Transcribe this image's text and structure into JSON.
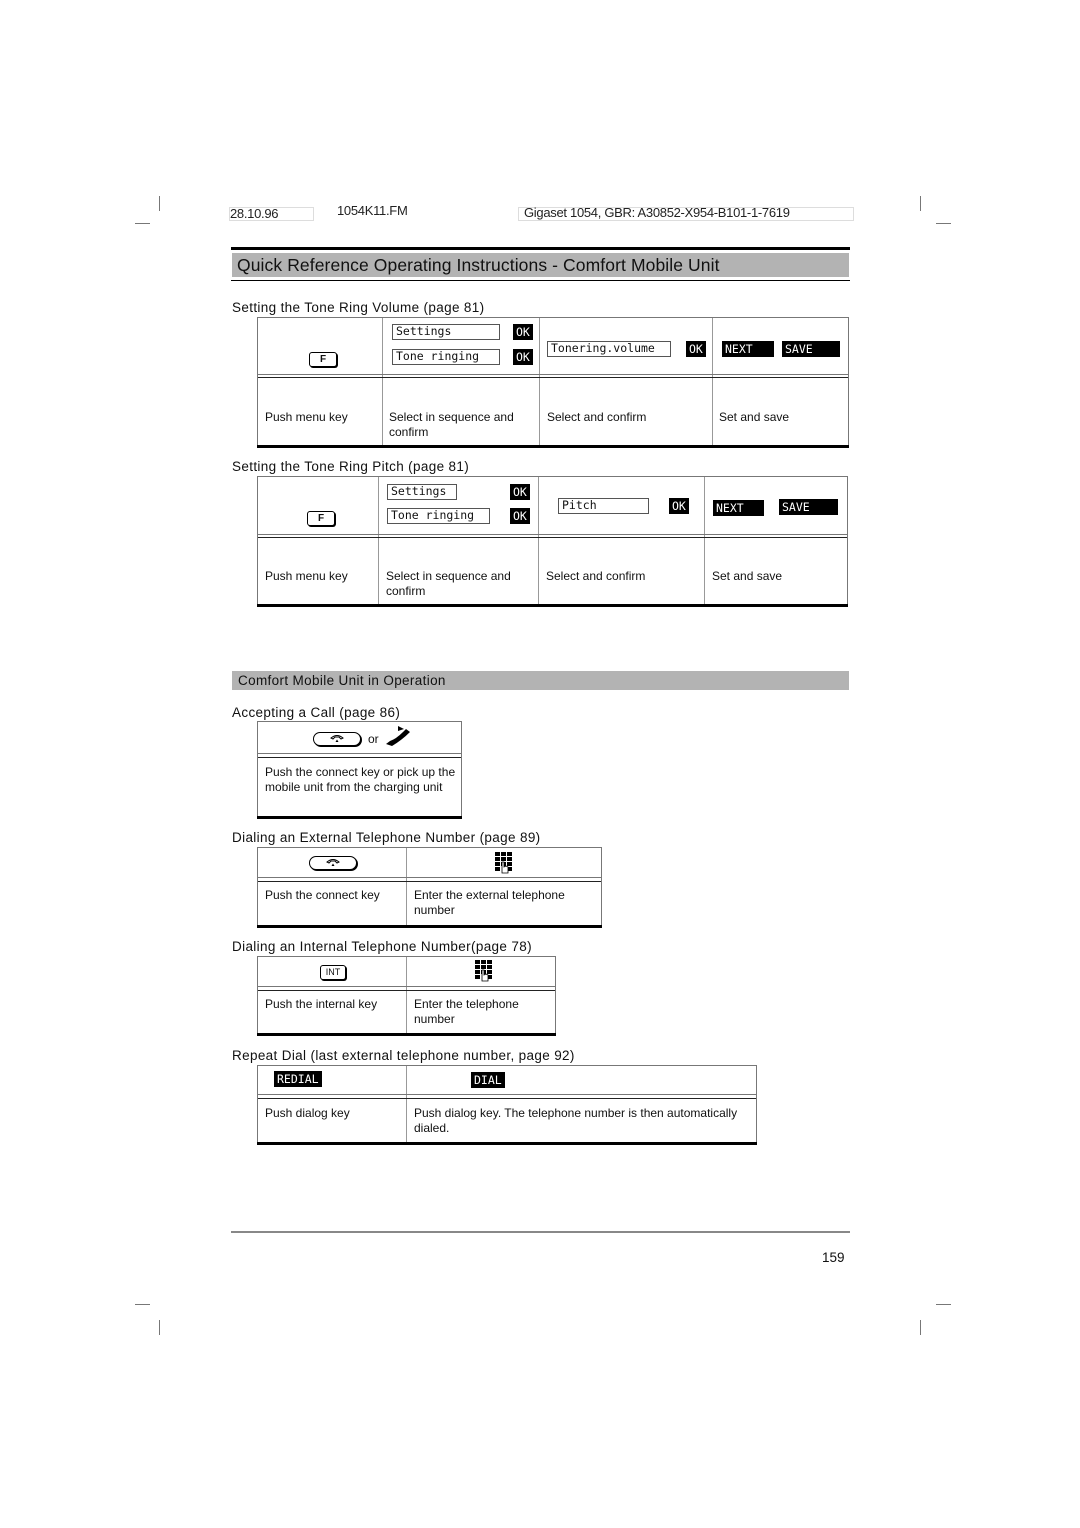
{
  "header": {
    "date": "28.10.96",
    "file": "1054K11.FM",
    "doc_id": "Gigaset 1054, GBR: A30852-X954-B101-1-7619"
  },
  "title": "Quick Reference Operating Instructions - Comfort Mobile Unit",
  "sections": {
    "volume": {
      "heading": "Setting the Tone Ring Volume (page 81)",
      "fkey": "F",
      "menu1": "Settings",
      "menu2": "Tone ringing",
      "ok": "OK",
      "select": "Tonering.volume",
      "next": "NEXT",
      "save": "SAVE",
      "desc": [
        "Push menu key",
        "Select in sequence and confirm",
        "Select and confirm",
        "Set and save"
      ]
    },
    "pitch": {
      "heading": "Setting the Tone Ring Pitch (page 81)",
      "fkey": "F",
      "menu1": "Settings",
      "menu2": "Tone ringing",
      "ok": "OK",
      "select": "Pitch",
      "next": "NEXT",
      "save": "SAVE",
      "desc": [
        "Push menu key",
        "Select in sequence and confirm",
        "Select and confirm",
        "Set and save"
      ]
    },
    "operation": {
      "heading": "Comfort Mobile Unit in Operation"
    },
    "accept": {
      "heading": "Accepting a Call (page 86)",
      "or": "or",
      "desc": "Push the connect key or pick up the mobile unit from the charging unit",
      "icons": [
        "connect-key-icon",
        "handset-pickup-icon"
      ]
    },
    "external": {
      "heading": "Dialing an External Telephone Number (page 89)",
      "desc": [
        "Push the connect key",
        "Enter the external telephone number"
      ],
      "icons": [
        "connect-key-icon",
        "keypad-icon"
      ]
    },
    "internal": {
      "heading": "Dialing an Internal Telephone Number(page 78)",
      "int_key": "INT",
      "desc": [
        "Push the internal key",
        "Enter the telephone number"
      ],
      "icons": [
        "int-key-icon",
        "keypad-icon"
      ]
    },
    "redial": {
      "heading": "Repeat Dial (last external telephone number, page 92)",
      "redial": "REDIAL",
      "dial": "DIAL",
      "desc": [
        "Push dialog key",
        "Push dialog key. The telephone number is then automatically dialed."
      ]
    }
  },
  "page_number": "159"
}
